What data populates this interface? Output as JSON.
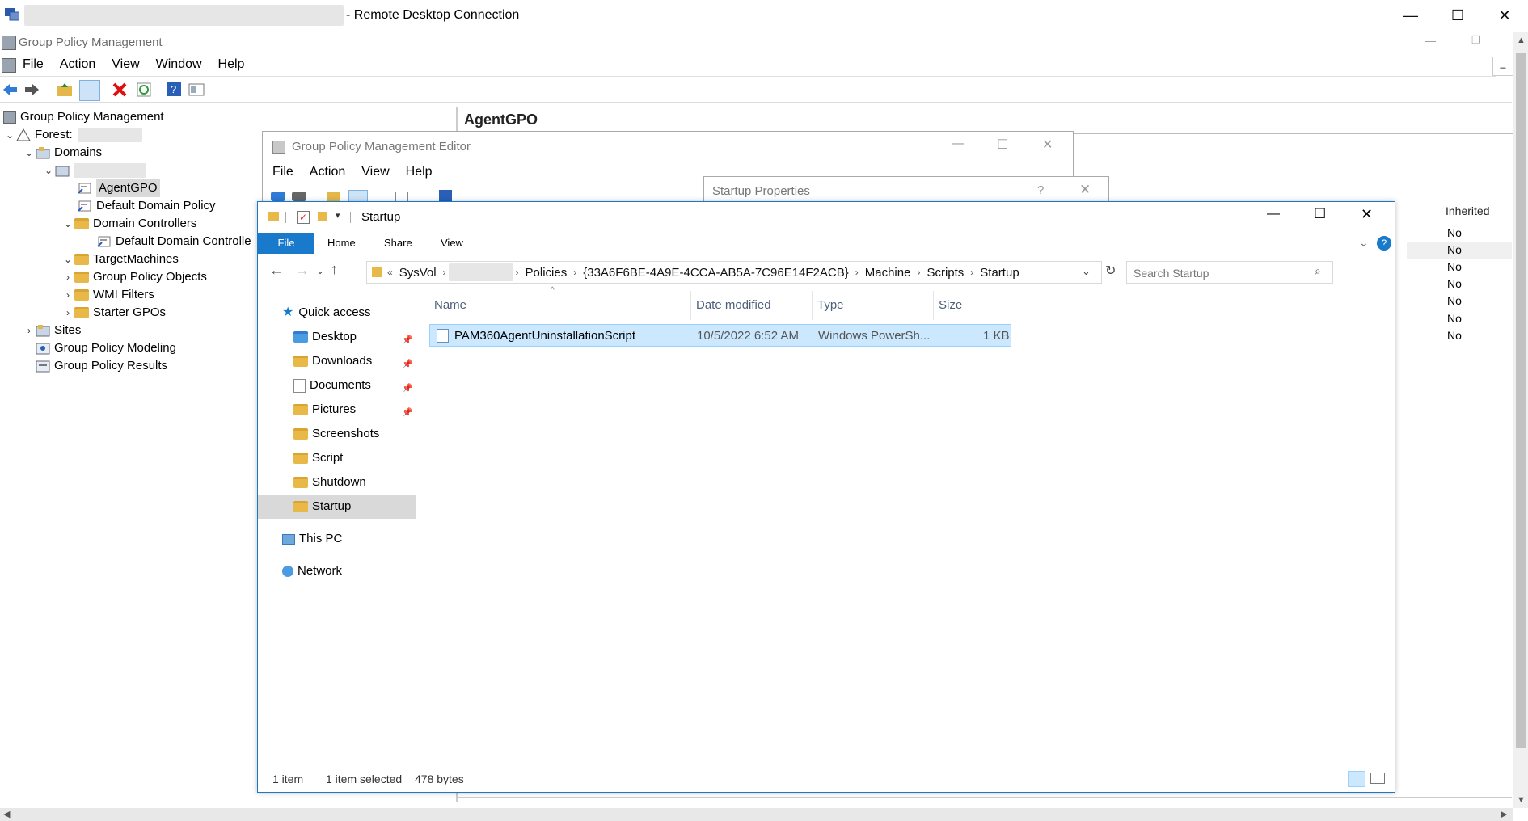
{
  "rdp": {
    "title": "- Remote Desktop Connection",
    "minimize": "—",
    "maximize": "☐",
    "close": "✕"
  },
  "gpm": {
    "title": "Group Policy Management",
    "menu": [
      "File",
      "Action",
      "View",
      "Window",
      "Help"
    ],
    "tree": {
      "root": "Group Policy Management",
      "forest": "Forest:",
      "domains": "Domains",
      "agentgpo": "AgentGPO",
      "default_domain_policy": "Default Domain Policy",
      "domain_controllers": "Domain Controllers",
      "default_domain_controllers": "Default Domain Controlle",
      "target_machines": "TargetMachines",
      "group_policy_objects": "Group Policy Objects",
      "wmi_filters": "WMI Filters",
      "starter_gpos": "Starter GPOs",
      "sites": "Sites",
      "modeling": "Group Policy Modeling",
      "results": "Group Policy Results"
    },
    "right_title": "AgentGPO",
    "inherited_header": "Inherited",
    "inherited_values": [
      "No",
      "No",
      "No",
      "No",
      "No",
      "No",
      "No"
    ]
  },
  "editor": {
    "title": "Group Policy Management Editor",
    "menu": [
      "File",
      "Action",
      "View",
      "Help"
    ]
  },
  "startup_props": {
    "title": "Startup Properties",
    "help": "?",
    "close": "✕"
  },
  "explorer": {
    "title": "Startup",
    "ribbon_tabs": [
      "File",
      "Home",
      "Share",
      "View"
    ],
    "breadcrumb": [
      "SysVol",
      "Policies",
      "{33A6F6BE-4A9E-4CCA-AB5A-7C96E14F2ACB}",
      "Machine",
      "Scripts",
      "Startup"
    ],
    "breadcrumb_prefix": "«",
    "search_placeholder": "Search Startup",
    "nav": {
      "quick_access": "Quick access",
      "items": [
        "Desktop",
        "Downloads",
        "Documents",
        "Pictures",
        "Screenshots",
        "Script",
        "Shutdown",
        "Startup"
      ],
      "this_pc": "This PC",
      "network": "Network"
    },
    "columns": [
      "Name",
      "Date modified",
      "Type",
      "Size"
    ],
    "files": [
      {
        "name": "PAM360AgentUninstallationScript",
        "date": "10/5/2022 6:52 AM",
        "type": "Windows PowerSh...",
        "size": "1 KB"
      }
    ],
    "status": {
      "count": "1 item",
      "selected": "1 item selected",
      "bytes": "478 bytes"
    }
  },
  "colors": {
    "accent": "#0063b1",
    "selection": "#cce8ff",
    "file_tab": "#1979ca"
  }
}
